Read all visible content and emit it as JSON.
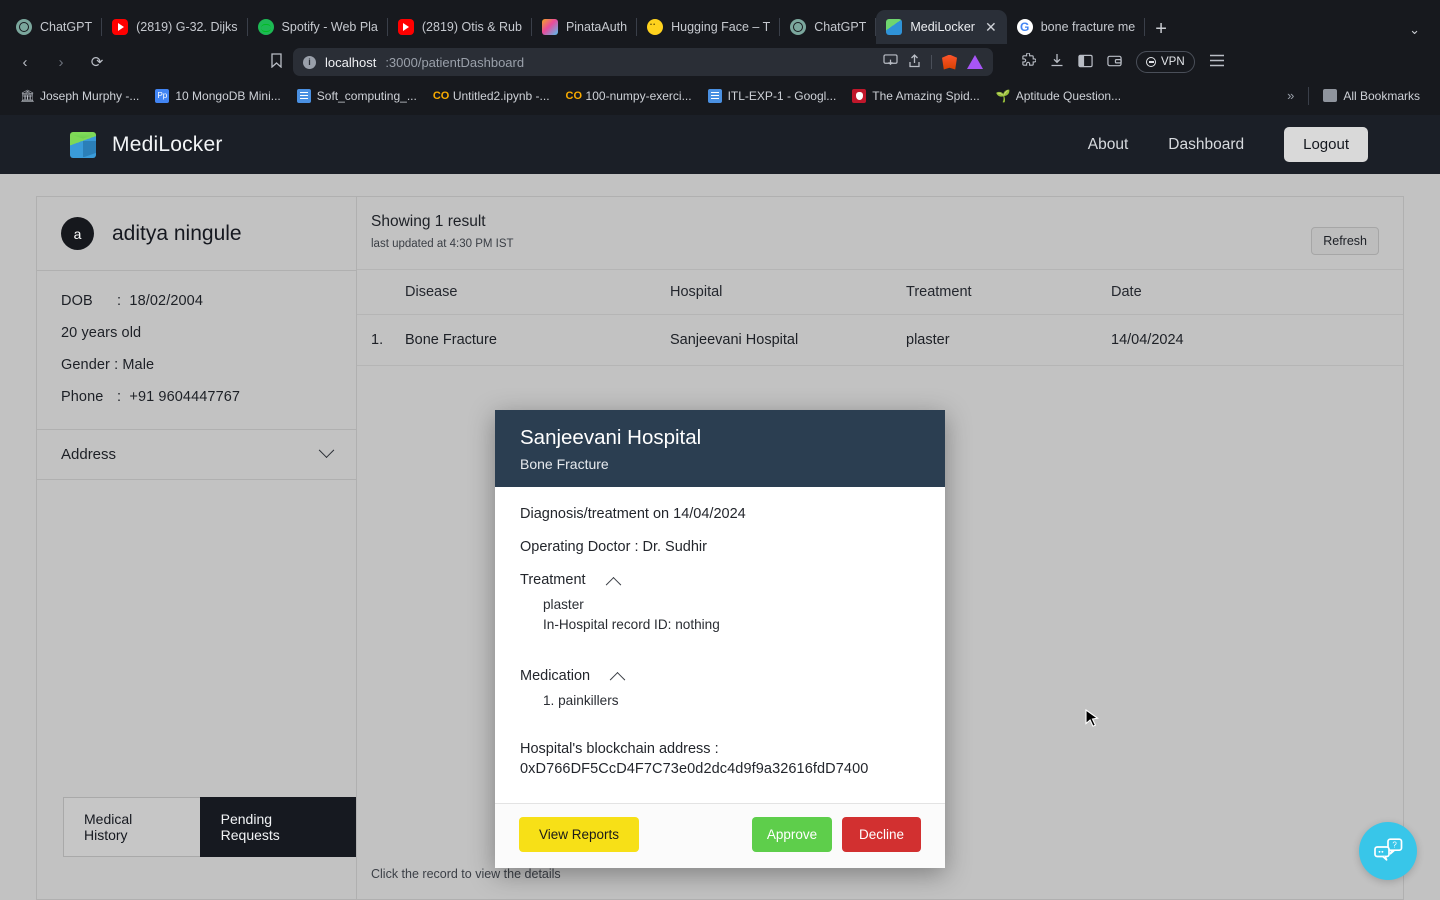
{
  "browser": {
    "tabs": [
      {
        "label": "ChatGPT",
        "icon": "chatgpt-icon",
        "active": false
      },
      {
        "label": "(2819) G-32. Dijks",
        "icon": "youtube-icon",
        "active": false
      },
      {
        "label": "Spotify - Web Pla",
        "icon": "spotify-icon",
        "active": false
      },
      {
        "label": "(2819) Otis & Rub",
        "icon": "youtube-icon",
        "active": false
      },
      {
        "label": "PinataAuth",
        "icon": "pinata-icon",
        "active": false
      },
      {
        "label": "Hugging Face – T",
        "icon": "huggingface-icon",
        "active": false
      },
      {
        "label": "ChatGPT",
        "icon": "chatgpt-icon",
        "active": false
      },
      {
        "label": "MediLocker",
        "icon": "medilocker-icon",
        "active": true
      },
      {
        "label": "bone fracture me",
        "icon": "google-icon",
        "active": false
      }
    ],
    "new_tab_label": "+",
    "tab_list_chevron": "⌄",
    "nav": {
      "back": "‹",
      "forward": "›",
      "reload": "⟳",
      "bookmark": "🔖"
    },
    "url": {
      "host": "localhost",
      "path": ":3000/patientDashboard",
      "info_icon": "i"
    },
    "vpn_label": "VPN",
    "bookmarks": [
      {
        "label": "Joseph Murphy -...",
        "icon": "bank-icon"
      },
      {
        "label": "10 MongoDB Mini...",
        "icon": "perplexity-icon"
      },
      {
        "label": "Soft_computing_...",
        "icon": "docs-icon"
      },
      {
        "label": "Untitled2.ipynb -...",
        "icon": "colab-icon"
      },
      {
        "label": "100-numpy-exerci...",
        "icon": "colab-icon"
      },
      {
        "label": "ITL-EXP-1 - Googl...",
        "icon": "docs-icon"
      },
      {
        "label": "The Amazing Spid...",
        "icon": "spider-icon"
      },
      {
        "label": "Aptitude Question...",
        "icon": "leaf-icon"
      }
    ],
    "bookmarks_overflow": "»",
    "all_bookmarks_label": "All Bookmarks"
  },
  "app": {
    "brand": "MediLocker",
    "nav_links": [
      "About",
      "Dashboard"
    ],
    "logout_label": "Logout"
  },
  "patient": {
    "avatar_initial": "a",
    "name": "aditya ningule",
    "dob_label": "DOB",
    "dob_sep": ":",
    "dob_value": "18/02/2004",
    "age": "20 years old",
    "gender": "Gender : Male",
    "phone_label": "Phone",
    "phone_sep": ":",
    "phone_value": "+91 9604447767",
    "address_label": "Address"
  },
  "tabs_toggle": {
    "medical_history": "Medical History",
    "pending_requests": "Pending Requests",
    "active": "Pending Requests"
  },
  "records": {
    "showing": "Showing 1 result",
    "last_updated": "last updated at 4:30 PM IST",
    "refresh_label": "Refresh",
    "columns": [
      "Disease",
      "Hospital",
      "Treatment",
      "Date"
    ],
    "rows": [
      {
        "index": "1.",
        "disease": "Bone Fracture",
        "hospital": "Sanjeevani Hospital",
        "treatment": "plaster",
        "date": "14/04/2024"
      }
    ],
    "hint": "Click the record to view the details"
  },
  "modal": {
    "title": "Sanjeevani Hospital",
    "subtitle": "Bone Fracture",
    "diagnosis_line": "Diagnosis/treatment on 14/04/2024",
    "doctor_line": "Operating Doctor : Dr. Sudhir",
    "treatment_label": "Treatment",
    "treatment_items": [
      "plaster",
      "In-Hospital record ID: nothing"
    ],
    "medication_label": "Medication",
    "medication_items": [
      "1. painkillers"
    ],
    "blockchain_label": "Hospital's blockchain address :",
    "blockchain_value": "0xD766DF5CcD4F7C73e0d2dc4d9f9a32616fdD7400",
    "view_reports_label": "View Reports",
    "approve_label": "Approve",
    "decline_label": "Decline"
  },
  "colors": {
    "modal_header": "#2b3e51",
    "page_bg": "#c2c2c2",
    "app_header": "#1b1f27",
    "approve": "#5ece4b",
    "decline": "#d23030",
    "view_reports": "#f7e017",
    "chat_fab": "#38c6e9"
  }
}
